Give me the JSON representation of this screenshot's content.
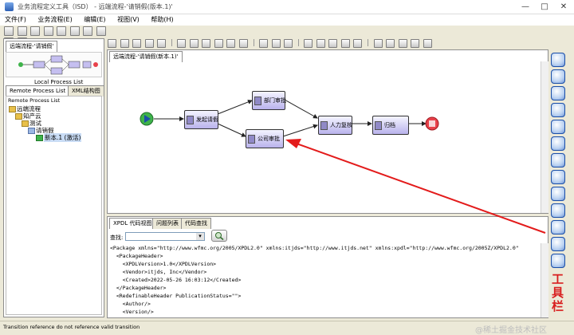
{
  "window": {
    "title": "业务流程定义工具（ISD） - 远端流程-'请销假(版本.1)'",
    "controls": [
      "—",
      "□",
      "✕"
    ]
  },
  "menu": [
    "文件(F)",
    "业务流程(E)",
    "编辑(E)",
    "视图(V)",
    "帮助(H)"
  ],
  "left": {
    "doc_tab": "远端流程-'请销假'",
    "tabs": [
      "Local Process List",
      "Remote Process List",
      "XML结构图"
    ],
    "tree_header": "Remote Process List",
    "tree": [
      "远端流程",
      "知产云",
      "测试",
      "请销假",
      "新本.1 (激活)"
    ]
  },
  "editor": {
    "tab": "远端流程-'请销假(新本.1)'",
    "nodes": {
      "start": "",
      "launch": "发起请假",
      "dept": "部门审批",
      "company": "公司审批",
      "hr": "人力复核",
      "archive": "归档",
      "end": ""
    }
  },
  "bottom": {
    "tabs": [
      "XPDL 代码视图",
      "问题列表",
      "代码查找"
    ],
    "search_label": "查找:",
    "search_value": "",
    "code_lines": [
      "<Package xmlns=\"http://www.wfmc.org/2005/XPDL2.0\" xmlns:itjds=\"http://www.itjds.net\" xmlns:xpdl=\"http://www.wfmc.org/2005Z/XPDL2.0\"",
      "  <PackageHeader>",
      "    <XPDLVersion>1.0</XPDLVersion>",
      "    <Vendor>itjds, Inc</Vendor>",
      "    <Created>2022-05-26 16:03:12</Created>",
      "  </PackageHeader>",
      "  <RedefinableHeader PublicationStatus=\"\">",
      "    <Author/>",
      "    <Version/>"
    ]
  },
  "annotation": {
    "label": "工具栏",
    "color": "#d81e1e"
  },
  "status": "Transition reference do not reference valid transition",
  "watermark": "@稀土掘金技术社区",
  "colors": {
    "node_fill": "#c5bff0",
    "start_fill": "#3eb34a",
    "end_fill": "#e8414a",
    "arrow": "#e31b1b",
    "toolbar_button": "#bcd3f2"
  }
}
